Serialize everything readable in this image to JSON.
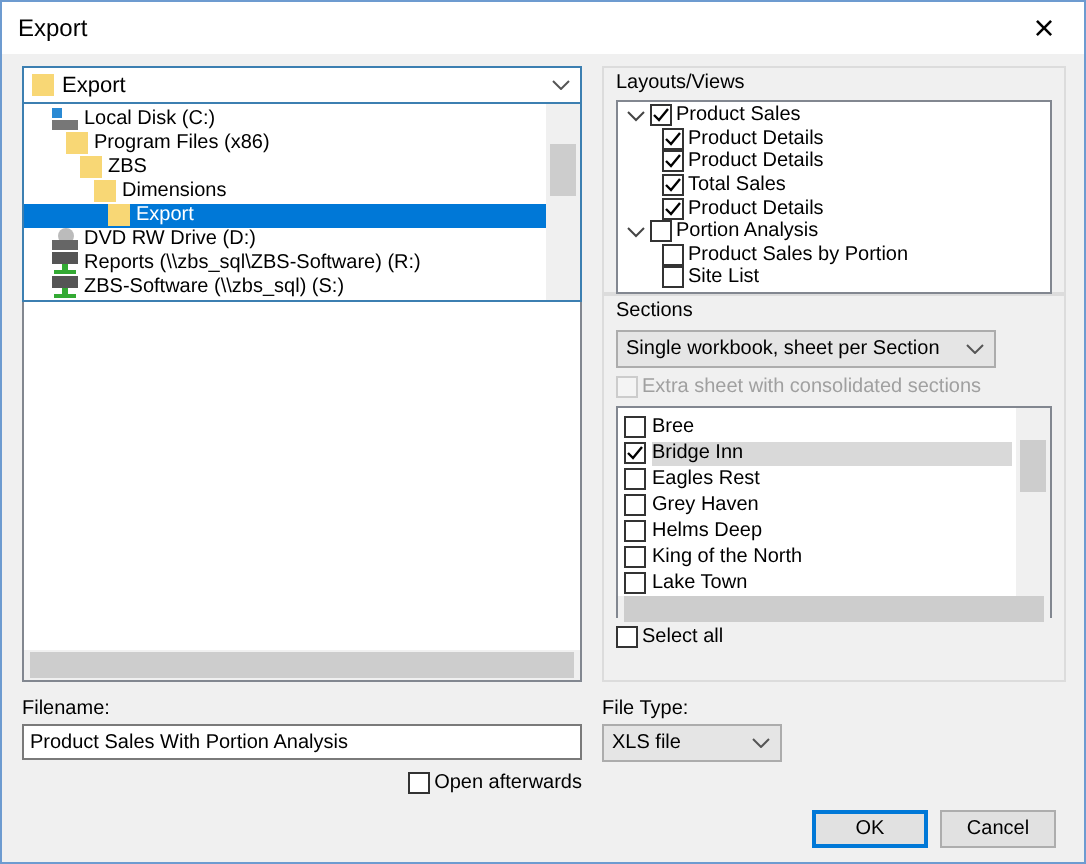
{
  "window": {
    "title": "Export",
    "close": "×"
  },
  "folder_combo": {
    "value": "Export",
    "open": true
  },
  "folder_dropdown": [
    {
      "label": "Local Disk (C:)",
      "kind": "drive",
      "selected": false,
      "children": [
        {
          "label": "Program Files (x86)",
          "kind": "folder",
          "selected": false,
          "children": [
            {
              "label": "ZBS",
              "kind": "folder",
              "selected": false,
              "children": [
                {
                  "label": "Dimensions",
                  "kind": "folder",
                  "selected": false,
                  "children": [
                    {
                      "label": "Export",
                      "kind": "folder",
                      "selected": true
                    }
                  ]
                }
              ]
            }
          ]
        }
      ]
    },
    {
      "label": "DVD RW Drive (D:)",
      "kind": "dvd",
      "selected": false
    },
    {
      "label": "Reports (\\\\zbs_sql\\ZBS-Software) (R:)",
      "kind": "network",
      "selected": false
    },
    {
      "label": "ZBS-Software (\\\\zbs_sql) (S:)",
      "kind": "network",
      "selected": false
    }
  ],
  "layouts": {
    "title": "Layouts/Views",
    "items": [
      {
        "label": "Product Sales",
        "checked": true,
        "expanded": true,
        "children": [
          {
            "label": "Product Details",
            "checked": true
          },
          {
            "label": "Product Details",
            "checked": true
          },
          {
            "label": "Total Sales",
            "checked": true
          },
          {
            "label": "Product Details",
            "checked": true
          }
        ]
      },
      {
        "label": "Portion Analysis",
        "checked": false,
        "expanded": true,
        "children": [
          {
            "label": "Product Sales by Portion",
            "checked": false
          },
          {
            "label": "Site List",
            "checked": false
          }
        ]
      }
    ]
  },
  "sections": {
    "title": "Sections",
    "mode": "Single workbook, sheet per Section",
    "extra_sheet": {
      "label": "Extra sheet with consolidated sections",
      "checked": false,
      "disabled": true
    },
    "items": [
      {
        "label": "Bree",
        "checked": false,
        "selected": false
      },
      {
        "label": "Bridge Inn",
        "checked": true,
        "selected": true
      },
      {
        "label": "Eagles Rest",
        "checked": false,
        "selected": false
      },
      {
        "label": "Grey Haven",
        "checked": false,
        "selected": false
      },
      {
        "label": "Helms Deep",
        "checked": false,
        "selected": false
      },
      {
        "label": "King of the North",
        "checked": false,
        "selected": false
      },
      {
        "label": "Lake Town",
        "checked": false,
        "selected": false
      }
    ],
    "select_all": {
      "label": "Select all",
      "checked": false
    }
  },
  "filename": {
    "label": "Filename:",
    "value": "Product Sales With Portion Analysis"
  },
  "open_afterwards": {
    "label": "Open afterwards",
    "checked": false
  },
  "file_type": {
    "label": "File Type:",
    "value": "XLS file"
  },
  "buttons": [
    {
      "label": "OK",
      "default": true
    },
    {
      "label": "Cancel",
      "default": false
    }
  ]
}
